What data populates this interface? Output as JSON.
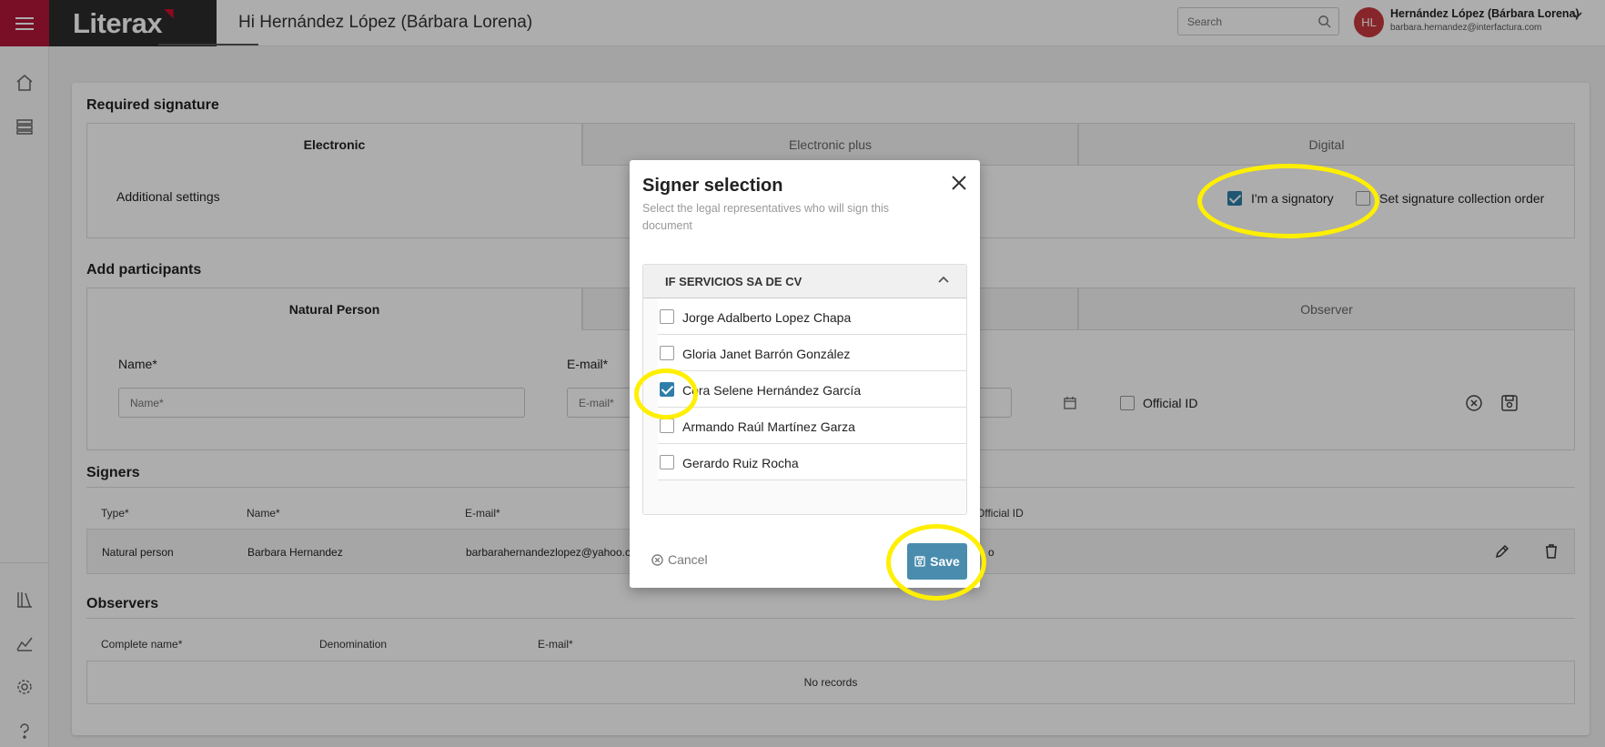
{
  "app": {
    "logo": "Literax",
    "greeting": "Hi Hernández López (Bárbara Lorena)"
  },
  "header": {
    "search_placeholder": "Search",
    "avatar_initials": "HL",
    "user_name": "Hernández López (Bárbara Lorena)",
    "user_email": "barbara.hernandez@interfactura.com"
  },
  "required_signature": {
    "title": "Required signature",
    "tabs": [
      "Electronic",
      "Electronic plus",
      "Digital"
    ],
    "additional_settings": "Additional settings",
    "im_signatory_label": "I'm a signatory",
    "im_signatory_checked": true,
    "collection_order_label": "Set signature collection order"
  },
  "add_participants": {
    "title": "Add participants",
    "tabs": [
      "Natural Person",
      "Observer"
    ],
    "name_label": "Name*",
    "name_placeholder": "Name*",
    "email_label": "E-mail*",
    "email_placeholder": "E-mail*",
    "official_id_label": "Official ID"
  },
  "signers": {
    "title": "Signers",
    "columns": [
      "Type*",
      "Name*",
      "E-mail*",
      "Official ID"
    ],
    "rows": [
      {
        "type": "Natural person",
        "name": "Barbara Hernandez",
        "email": "barbarahernandezlopez@yahoo.co",
        "official_id": "o"
      }
    ]
  },
  "observers": {
    "title": "Observers",
    "columns": [
      "Complete name*",
      "Denomination",
      "E-mail*"
    ],
    "empty": "No records"
  },
  "modal": {
    "title": "Signer selection",
    "subtitle": "Select the legal representatives who will sign this document",
    "group_title": "IF SERVICIOS SA DE CV",
    "signers": [
      {
        "name": "Jorge Adalberto Lopez Chapa",
        "checked": false
      },
      {
        "name": "Gloria Janet Barrón González",
        "checked": false
      },
      {
        "name": "Cora Selene Hernández García",
        "checked": true
      },
      {
        "name": "Armando Raúl Martínez Garza",
        "checked": false
      },
      {
        "name": "Gerardo Ruiz Rocha",
        "checked": false
      }
    ],
    "cancel_label": "Cancel",
    "save_label": "Save"
  },
  "colors": {
    "brand_red": "#b3163a",
    "primary_blue": "#4a8cae",
    "check_blue": "#2f7eaa",
    "highlight_yellow": "#ffef00"
  }
}
